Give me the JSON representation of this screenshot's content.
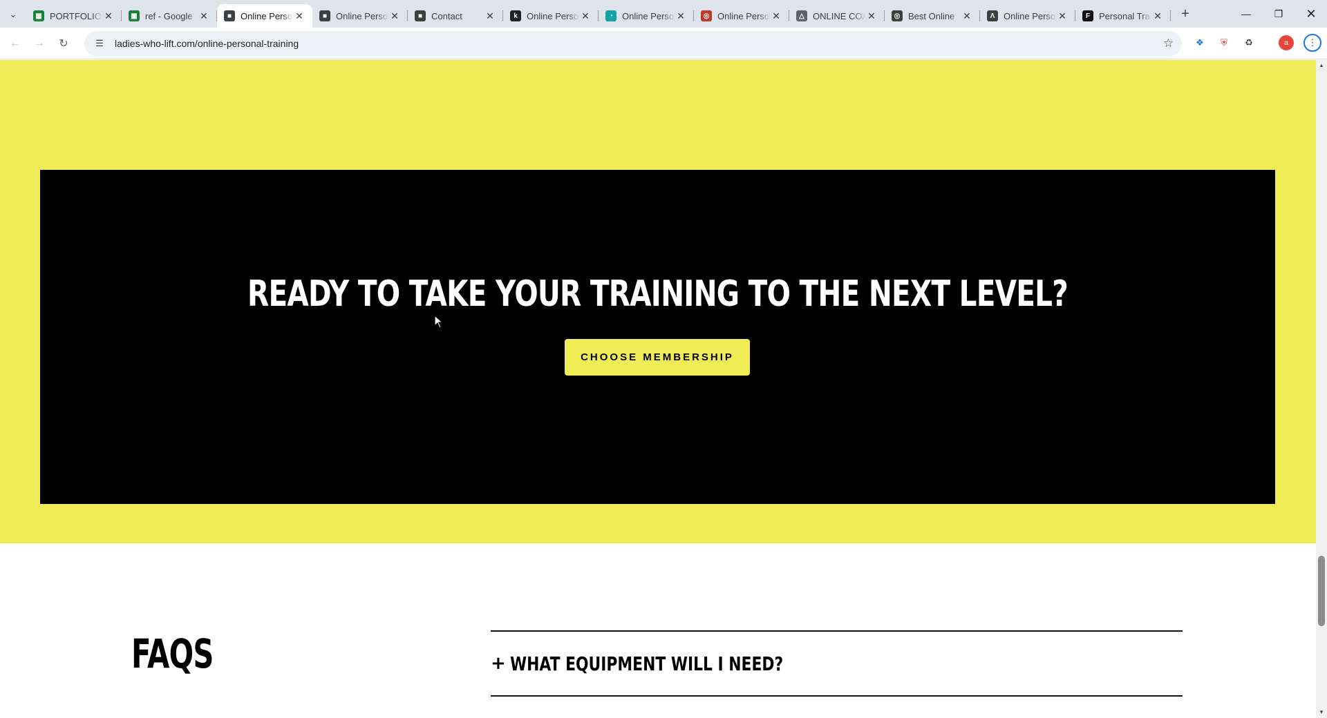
{
  "browser": {
    "tabs": [
      {
        "title": "PORTFOLIO",
        "icon": "sheets-icon",
        "color": "#188038"
      },
      {
        "title": "ref - Google",
        "icon": "sheets-icon",
        "color": "#188038"
      },
      {
        "title": "Online Perso",
        "icon": "cube-icon",
        "color": "#3c4043",
        "active": true
      },
      {
        "title": "Online Perso",
        "icon": "cube-icon",
        "color": "#3c4043"
      },
      {
        "title": "Contact",
        "icon": "cube-icon",
        "color": "#3c4043"
      },
      {
        "title": "Online Perso",
        "icon": "k-icon",
        "color": "#202124"
      },
      {
        "title": "Online Perso",
        "icon": "chart-icon",
        "color": "#12a4a4"
      },
      {
        "title": "Online Perso",
        "icon": "globe-icon",
        "color": "#c0392b"
      },
      {
        "title": "ONLINE COA",
        "icon": "logo-icon",
        "color": "#5f6368"
      },
      {
        "title": "Best Online",
        "icon": "globe-icon",
        "color": "#3c4043"
      },
      {
        "title": "Online Perso",
        "icon": "mountain-icon",
        "color": "#3c4043"
      },
      {
        "title": "Personal Tra",
        "icon": "fs-icon",
        "color": "#111111"
      }
    ],
    "url": "ladies-who-lift.com/online-personal-training",
    "profile_initial": "a"
  },
  "page": {
    "cta_heading": "READY TO TAKE YOUR TRAINING TO THE NEXT LEVEL?",
    "cta_button": "CHOOSE MEMBERSHIP",
    "faqs_title": "FAQS",
    "faqs": [
      {
        "question": "WHAT EQUIPMENT WILL I NEED?"
      }
    ]
  },
  "colors": {
    "brand_yellow": "#efec55",
    "cta_background": "#000000"
  }
}
